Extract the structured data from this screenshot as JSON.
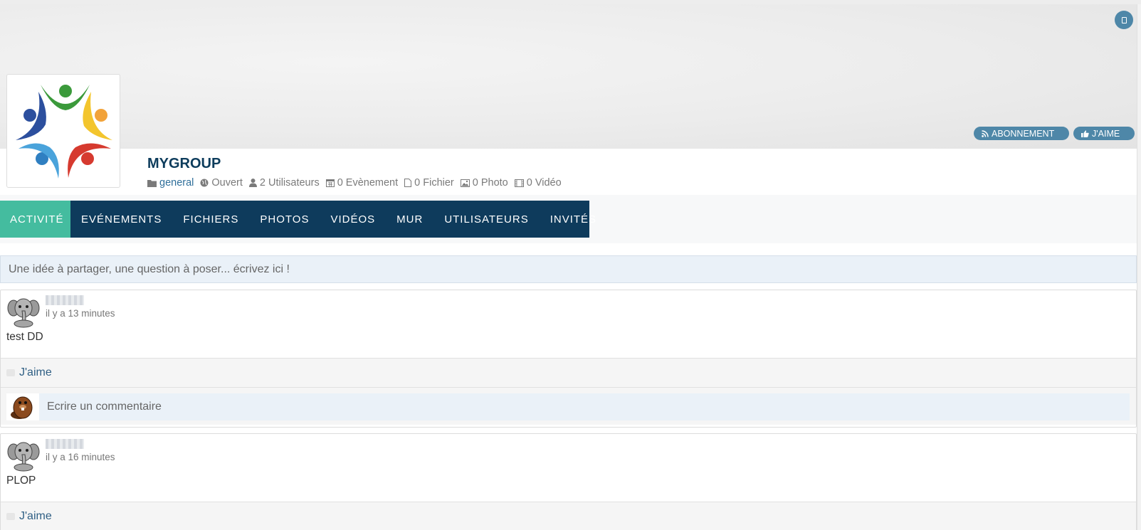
{
  "group": {
    "title": "MYGROUP",
    "meta": {
      "category": "general",
      "status": "Ouvert",
      "users": "2 Utilisateurs",
      "events": "0 Evènement",
      "files": "0 Fichier",
      "photos": "0 Photo",
      "videos": "0 Vidéo"
    }
  },
  "header_buttons": {
    "subscribe": "ABONNEMENT",
    "like": "J'AIME"
  },
  "nav": {
    "tabs": [
      {
        "label": "ACTIVITÉ",
        "active": true
      },
      {
        "label": "EVÉNEMENTS"
      },
      {
        "label": "FICHIERS"
      },
      {
        "label": "PHOTOS"
      },
      {
        "label": "VIDÉOS"
      },
      {
        "label": "MUR"
      },
      {
        "label": "UTILISATEURS"
      },
      {
        "label": "INVITÉS"
      }
    ]
  },
  "composer": {
    "placeholder": "Une idée à partager, une question à poser... écrivez ici !"
  },
  "posts": [
    {
      "time": "il y a 13 minutes",
      "body": "test DD",
      "like_label": "J'aime",
      "comment_placeholder": "Ecrire un commentaire"
    },
    {
      "time": "il y a 16 minutes",
      "body": "PLOP",
      "like_label": "J'aime"
    }
  ],
  "colors": {
    "nav_bg": "#0e3b5c",
    "nav_active": "#44bc9f",
    "accent": "#4e87a8",
    "title": "#0d3c5c"
  },
  "icons": {
    "corner": "tablet-icon",
    "subscribe": "rss-icon",
    "like": "thumbs-up-icon"
  }
}
